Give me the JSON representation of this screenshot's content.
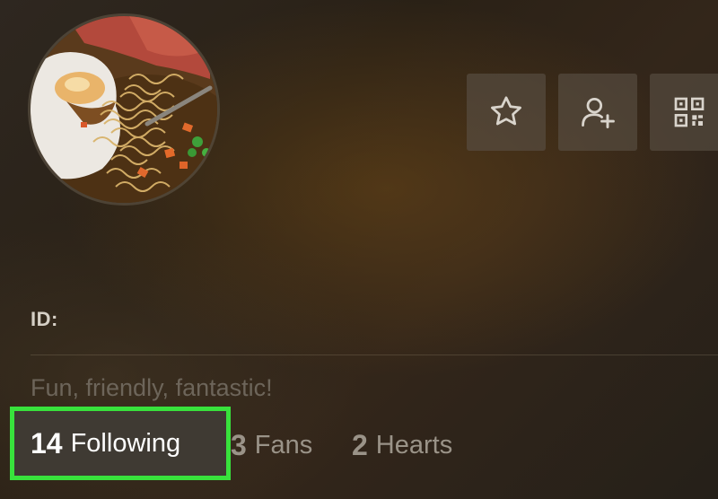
{
  "profile": {
    "avatar_icon": "profile-photo-ramen-bowl",
    "id_label": "ID:",
    "bio": "Fun, friendly, fantastic!"
  },
  "actions": {
    "favorite_icon": "star-icon",
    "add_friend_icon": "add-user-icon",
    "qr_icon": "qr-code-icon"
  },
  "stats": {
    "following": {
      "count": "14",
      "label": "Following"
    },
    "fans": {
      "count": "3",
      "label": "Fans"
    },
    "hearts": {
      "count": "2",
      "label": "Hearts"
    }
  },
  "colors": {
    "highlight": "#38e23c"
  }
}
